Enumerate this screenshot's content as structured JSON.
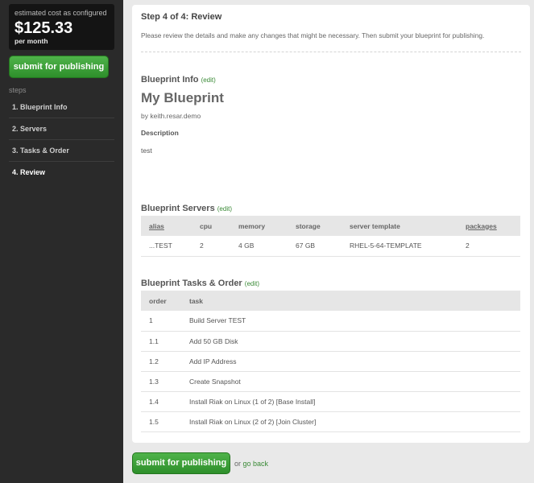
{
  "sidebar": {
    "cost_label": "estimated cost as configured",
    "cost_value": "$125.33",
    "cost_period": "per month",
    "submit_label": "submit for publishing",
    "steps_label": "steps",
    "steps": [
      "1. Blueprint Info",
      "2. Servers",
      "3. Tasks & Order",
      "4. Review"
    ]
  },
  "main": {
    "step_title": "Step 4 of 4: Review",
    "intro": "Please review the details and make any changes that might be necessary. Then submit your blueprint for publishing.",
    "info_heading": "Blueprint Info",
    "edit_label": "(edit)",
    "blueprint_name": "My Blueprint",
    "by_line": "by keith.resar.demo",
    "description_label": "Description",
    "description_value": "test",
    "servers_heading": "Blueprint Servers",
    "servers": {
      "columns": [
        "alias",
        "cpu",
        "memory",
        "storage",
        "server template",
        "packages"
      ],
      "rows": [
        [
          "...TEST",
          "2",
          "4 GB",
          "67 GB",
          "RHEL-5-64-TEMPLATE",
          "2"
        ]
      ]
    },
    "tasks_heading": "Blueprint Tasks & Order",
    "tasks": {
      "columns": [
        "order",
        "task"
      ],
      "rows": [
        [
          "1",
          "Build Server TEST"
        ],
        [
          "1.1",
          "Add 50 GB Disk"
        ],
        [
          "1.2",
          "Add IP Address"
        ],
        [
          "1.3",
          "Create Snapshot"
        ],
        [
          "1.4",
          "Install Riak on Linux (1 of 2) [Base Install]"
        ],
        [
          "1.5",
          "Install Riak on Linux (2 of 2) [Join Cluster]"
        ]
      ]
    }
  },
  "footer": {
    "submit_label": "submit for publishing",
    "or_text": "or",
    "back_label": "go back"
  }
}
